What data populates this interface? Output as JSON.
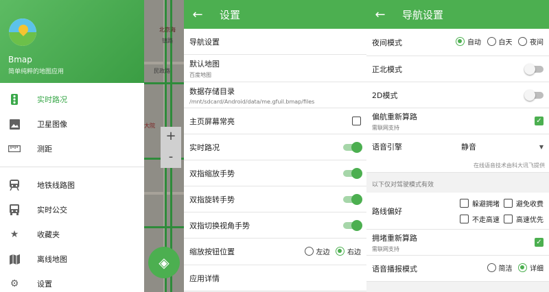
{
  "drawer": {
    "app_name": "Bmap",
    "app_subtitle": "简单纯粹的地图应用",
    "items": [
      {
        "label": "实时路况",
        "icon": "traffic-light-icon",
        "active": true
      },
      {
        "label": "卫星图像",
        "icon": "image-icon"
      },
      {
        "label": "测距",
        "icon": "ruler-icon"
      },
      {
        "label": "地铁线路图",
        "icon": "subway-icon"
      },
      {
        "label": "实时公交",
        "icon": "bus-icon"
      },
      {
        "label": "收藏夹",
        "icon": "star-icon"
      },
      {
        "label": "离线地图",
        "icon": "map-icon"
      },
      {
        "label": "设置",
        "icon": "gear-icon"
      }
    ]
  },
  "map": {
    "labels": [
      "北京海",
      "镇路",
      "民政路",
      "大院"
    ],
    "zoom_in": "+",
    "zoom_out": "-"
  },
  "settings": {
    "title": "设置",
    "nav_settings": "导航设置",
    "default_map": {
      "label": "默认地图",
      "value": "百度地图"
    },
    "storage": {
      "label": "数据存储目录",
      "value": "/mnt/sdcard/Android/data/me.gfuil.bmap/files"
    },
    "keep_screen_on": {
      "label": "主页屏幕常亮",
      "checked": false
    },
    "traffic": {
      "label": "实时路况",
      "on": true
    },
    "pinch_zoom": {
      "label": "双指缩放手势",
      "on": true
    },
    "rotate": {
      "label": "双指旋转手势",
      "on": true
    },
    "tilt": {
      "label": "双指切换视角手势",
      "on": true
    },
    "zoom_position": {
      "label": "缩放按钮位置",
      "options": [
        "左边",
        "右边"
      ],
      "selected": "右边"
    },
    "app_details": "应用详情"
  },
  "nav": {
    "title": "导航设置",
    "night_mode": {
      "label": "夜间模式",
      "options": [
        "自动",
        "白天",
        "夜间"
      ],
      "selected": "自动"
    },
    "north_up": {
      "label": "正北模式",
      "on": false
    },
    "mode_2d": {
      "label": "2D模式",
      "on": false
    },
    "reroute_offcourse": {
      "label": "偏航重新算路",
      "sub": "需联网支持",
      "checked": true
    },
    "voice_engine": {
      "label": "语音引擎",
      "value": "静音"
    },
    "voice_note": "在线语音技术由科大讯飞提供",
    "driving_only_note": "以下仅对驾驶模式有效",
    "route_pref": {
      "label": "路线偏好",
      "options": [
        "躲避拥堵",
        "避免收费",
        "不走高速",
        "高速优先"
      ]
    },
    "reroute_congestion": {
      "label": "拥堵重新算路",
      "sub": "需联网支持",
      "checked": true
    },
    "broadcast_mode": {
      "label": "语音播报模式",
      "options": [
        "简洁",
        "详细"
      ],
      "selected": "详细"
    }
  },
  "colors": {
    "accent": "#4caf50",
    "active_text": "#3aa84a"
  }
}
